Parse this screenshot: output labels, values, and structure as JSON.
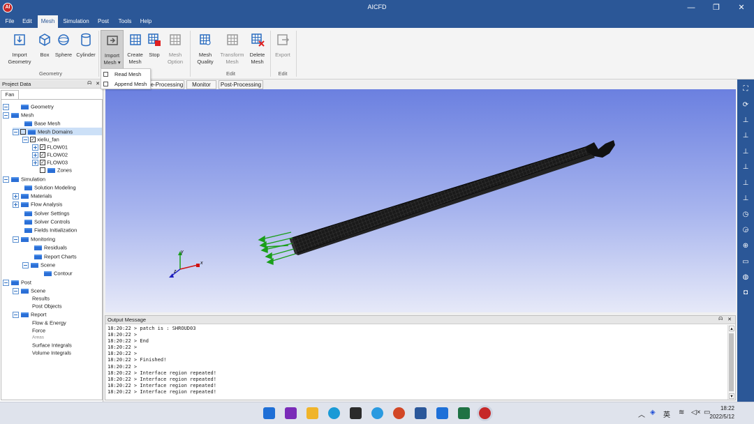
{
  "window": {
    "title": "AICFD",
    "app_icon_text": "AI",
    "buttons": {
      "minimize": "—",
      "restore": "❐",
      "close": "✕"
    }
  },
  "menu": [
    "File",
    "Edit",
    "Mesh",
    "Simulation",
    "Post",
    "Tools",
    "Help"
  ],
  "active_menu": "Mesh",
  "ribbon": {
    "geometry_group": {
      "label": "Geometry",
      "buttons": {
        "import_geometry": [
          "Import",
          "Geometry"
        ],
        "box": "Box",
        "sphere": "Sphere",
        "cylinder": "Cylinder"
      }
    },
    "mesh_group": {
      "buttons": {
        "import_mesh": [
          "Import",
          "Mesh ▾"
        ],
        "create_mesh": [
          "Create",
          "Mesh"
        ],
        "stop": "Stop",
        "mesh_option": [
          "Mesh",
          "Option"
        ]
      }
    },
    "edit_group": {
      "label": "Edit",
      "buttons": {
        "mesh_quality": [
          "Mesh",
          "Quality"
        ],
        "transform_mesh": [
          "Transform",
          "Mesh"
        ],
        "delete_mesh": [
          "Delete",
          "Mesh"
        ]
      }
    },
    "export_group": {
      "label": "Edit",
      "buttons": {
        "export": "Export"
      }
    },
    "accent_color": "#2b5797"
  },
  "dropdown": {
    "items": [
      "Read Mesh",
      "Append Mesh"
    ]
  },
  "project_panel": {
    "title": "Project Data",
    "pin": "ᗣ",
    "close": "✕",
    "tab": "Fan",
    "tree": {
      "geometry": "Geometry",
      "mesh": "Mesh",
      "base_mesh": "Base Mesh",
      "mesh_domains": "Mesh Domains",
      "xieliu_fan": "xieliu_fan",
      "flow01": "FLOW01",
      "flow02": "FLOW02",
      "flow03": "FLOW03",
      "zones": "Zones",
      "simulation": "Simulation",
      "solution_modeling": "Solution Modeling",
      "materials": "Materials",
      "flow_analysis": "Flow Analysis",
      "solver_settings": "Solver Settings",
      "solver_controls": "Solver Controls",
      "fields_initialization": "Fields Initialization",
      "monitoring": "Monitoring",
      "residuals": "Residuals",
      "report_charts": "Report Charts",
      "scene": "Scene",
      "contour": "Contour",
      "post": "Post",
      "post_scene": "Scene",
      "results": "Results",
      "post_objects": "Post Objects",
      "report": "Report",
      "flow_energy": "Flow & Energy",
      "force": "Force",
      "areas": "Areas",
      "surface_integrals": "Surface Integrals",
      "volume_integrals": "Volume Integrals"
    }
  },
  "view_tabs": [
    "e-Processing",
    "Monitor",
    "Post-Processing"
  ],
  "viewport": {
    "axis_labels": {
      "x": "x",
      "y": "y",
      "z": "z"
    }
  },
  "output": {
    "title": "Output Message",
    "pin": "ᗣ",
    "close": "✕",
    "lines": [
      "18:20:22 > patch is : SHROUD03",
      "18:20:22 >",
      "18:20:22 > End",
      "18:20:22 >",
      "18:20:22 >",
      "18:20:22 > Finished!",
      "18:20:22 >",
      "18:20:22 > Interface region repeated!",
      "18:20:22 > Interface region repeated!",
      "18:20:22 > Interface region repeated!",
      "18:20:22 > Interface region repeated!"
    ]
  },
  "taskbar": {
    "tray_lang": "英",
    "time": "18:22",
    "date": "2022/5/12"
  }
}
